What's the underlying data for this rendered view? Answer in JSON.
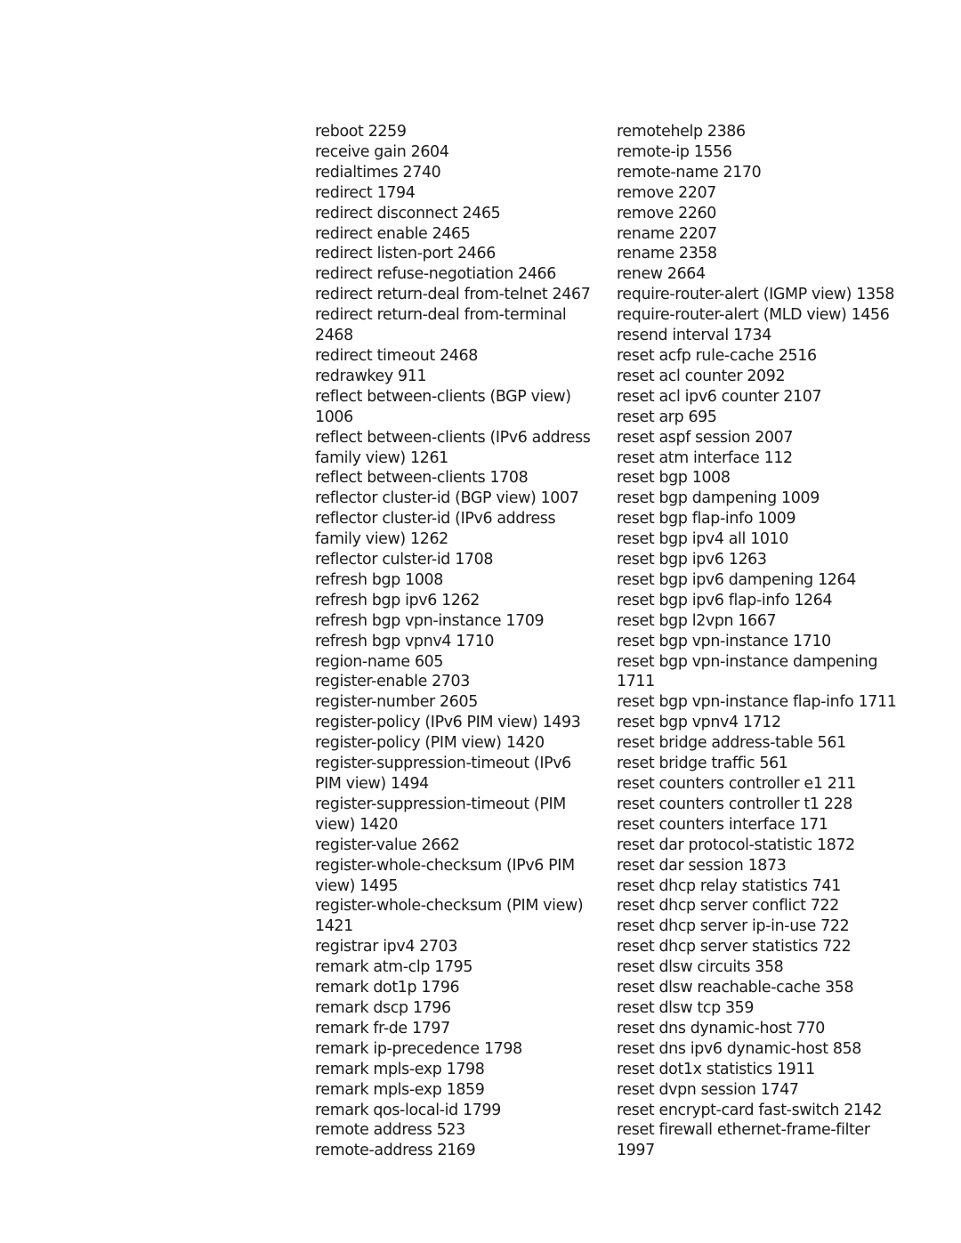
{
  "document": {
    "type": "command index",
    "columns": [
      {
        "entries": [
          {
            "term": "reboot",
            "page": "2259"
          },
          {
            "term": "receive gain",
            "page": "2604"
          },
          {
            "term": "redialtimes",
            "page": "2740"
          },
          {
            "term": "redirect",
            "page": "1794"
          },
          {
            "term": "redirect disconnect",
            "page": "2465"
          },
          {
            "term": "redirect enable",
            "page": "2465"
          },
          {
            "term": "redirect listen-port",
            "page": "2466"
          },
          {
            "term": "redirect refuse-negotiation",
            "page": "2466"
          },
          {
            "term": "redirect return-deal from-telnet",
            "page": "2467"
          },
          {
            "term": "redirect return-deal from-terminal",
            "page": "2468",
            "wrap": true
          },
          {
            "term": "redirect timeout",
            "page": "2468"
          },
          {
            "term": "redrawkey",
            "page": "911"
          },
          {
            "term": "reflect between-clients (BGP view)",
            "page": "1006",
            "wrap": true
          },
          {
            "term": "reflect between-clients (IPv6 address family view)",
            "page": "1261",
            "wrap": true
          },
          {
            "term": "reflect between-clients",
            "page": "1708"
          },
          {
            "term": "reflector cluster-id (BGP view)",
            "page": "1007"
          },
          {
            "term": "reflector cluster-id (IPv6 address family view)",
            "page": "1262",
            "wrap": true
          },
          {
            "term": "reflector culster-id",
            "page": "1708"
          },
          {
            "term": "refresh bgp",
            "page": "1008"
          },
          {
            "term": "refresh bgp ipv6",
            "page": "1262"
          },
          {
            "term": "refresh bgp vpn-instance",
            "page": "1709"
          },
          {
            "term": "refresh bgp vpnv4",
            "page": "1710"
          },
          {
            "term": "region-name",
            "page": "605"
          },
          {
            "term": "register-enable",
            "page": "2703"
          },
          {
            "term": "register-number",
            "page": "2605"
          },
          {
            "term": "register-policy (IPv6 PIM view)",
            "page": "1493"
          },
          {
            "term": "register-policy (PIM view)",
            "page": "1420"
          },
          {
            "term": "register-suppression-timeout (IPv6 PIM view)",
            "page": "1494",
            "wrap": true
          },
          {
            "term": "register-suppression-timeout (PIM view)",
            "page": "1420",
            "wrap": true
          },
          {
            "term": "register-value",
            "page": "2662"
          },
          {
            "term": "register-whole-checksum (IPv6 PIM view)",
            "page": "1495",
            "wrap": true
          },
          {
            "term": "register-whole-checksum (PIM view)",
            "page": "1421",
            "wrap": true
          },
          {
            "term": "registrar ipv4",
            "page": "2703"
          },
          {
            "term": "remark atm-clp",
            "page": "1795"
          },
          {
            "term": "remark dot1p",
            "page": "1796"
          },
          {
            "term": "remark dscp",
            "page": "1796"
          },
          {
            "term": "remark fr-de",
            "page": "1797"
          },
          {
            "term": "remark ip-precedence",
            "page": "1798"
          },
          {
            "term": "remark mpls-exp",
            "page": "1798"
          },
          {
            "term": "remark mpls-exp",
            "page": "1859"
          },
          {
            "term": "remark qos-local-id",
            "page": "1799"
          },
          {
            "term": "remote address",
            "page": "523"
          },
          {
            "term": "remote-address",
            "page": "2169"
          }
        ]
      },
      {
        "entries": [
          {
            "term": "remotehelp",
            "page": "2386"
          },
          {
            "term": "remote-ip",
            "page": "1556"
          },
          {
            "term": "remote-name",
            "page": "2170"
          },
          {
            "term": "remove",
            "page": "2207"
          },
          {
            "term": "remove",
            "page": "2260"
          },
          {
            "term": "rename",
            "page": "2207"
          },
          {
            "term": "rename",
            "page": "2358"
          },
          {
            "term": "renew",
            "page": "2664"
          },
          {
            "term": "require-router-alert (IGMP view)",
            "page": "1358"
          },
          {
            "term": "require-router-alert (MLD view)",
            "page": "1456"
          },
          {
            "term": "resend interval",
            "page": "1734"
          },
          {
            "term": "reset acfp rule-cache",
            "page": "2516"
          },
          {
            "term": "reset acl counter",
            "page": "2092"
          },
          {
            "term": "reset acl ipv6 counter",
            "page": "2107"
          },
          {
            "term": "reset arp",
            "page": "695"
          },
          {
            "term": "reset aspf session",
            "page": "2007"
          },
          {
            "term": "reset atm interface",
            "page": "112"
          },
          {
            "term": "reset bgp",
            "page": "1008"
          },
          {
            "term": "reset bgp dampening",
            "page": "1009"
          },
          {
            "term": "reset bgp flap-info",
            "page": "1009"
          },
          {
            "term": "reset bgp ipv4 all",
            "page": "1010"
          },
          {
            "term": "reset bgp ipv6",
            "page": "1263"
          },
          {
            "term": "reset bgp ipv6 dampening",
            "page": "1264"
          },
          {
            "term": "reset bgp ipv6 flap-info",
            "page": "1264"
          },
          {
            "term": "reset bgp l2vpn",
            "page": "1667"
          },
          {
            "term": "reset bgp vpn-instance",
            "page": "1710"
          },
          {
            "term": "reset bgp vpn-instance dampening",
            "page": "1711",
            "wrap": true
          },
          {
            "term": "reset bgp vpn-instance flap-info",
            "page": "1711"
          },
          {
            "term": "reset bgp vpnv4",
            "page": "1712"
          },
          {
            "term": "reset bridge address-table",
            "page": "561"
          },
          {
            "term": "reset bridge traffic",
            "page": "561"
          },
          {
            "term": "reset counters controller e1",
            "page": "211"
          },
          {
            "term": "reset counters controller t1",
            "page": "228"
          },
          {
            "term": "reset counters interface",
            "page": "171"
          },
          {
            "term": "reset dar protocol-statistic",
            "page": "1872"
          },
          {
            "term": "reset dar session",
            "page": "1873"
          },
          {
            "term": "reset dhcp relay statistics",
            "page": "741"
          },
          {
            "term": "reset dhcp server conflict",
            "page": "722"
          },
          {
            "term": "reset dhcp server ip-in-use",
            "page": "722"
          },
          {
            "term": "reset dhcp server statistics",
            "page": "722"
          },
          {
            "term": "reset dlsw circuits",
            "page": "358"
          },
          {
            "term": "reset dlsw reachable-cache",
            "page": "358"
          },
          {
            "term": "reset dlsw tcp",
            "page": "359"
          },
          {
            "term": "reset dns dynamic-host",
            "page": "770"
          },
          {
            "term": "reset dns ipv6 dynamic-host",
            "page": "858"
          },
          {
            "term": "reset dot1x statistics",
            "page": "1911"
          },
          {
            "term": "reset dvpn session",
            "page": "1747"
          },
          {
            "term": "reset encrypt-card fast-switch",
            "page": "2142"
          },
          {
            "term": "reset firewall ethernet-frame-filter",
            "page": "1997",
            "wrap": true
          }
        ]
      }
    ]
  }
}
